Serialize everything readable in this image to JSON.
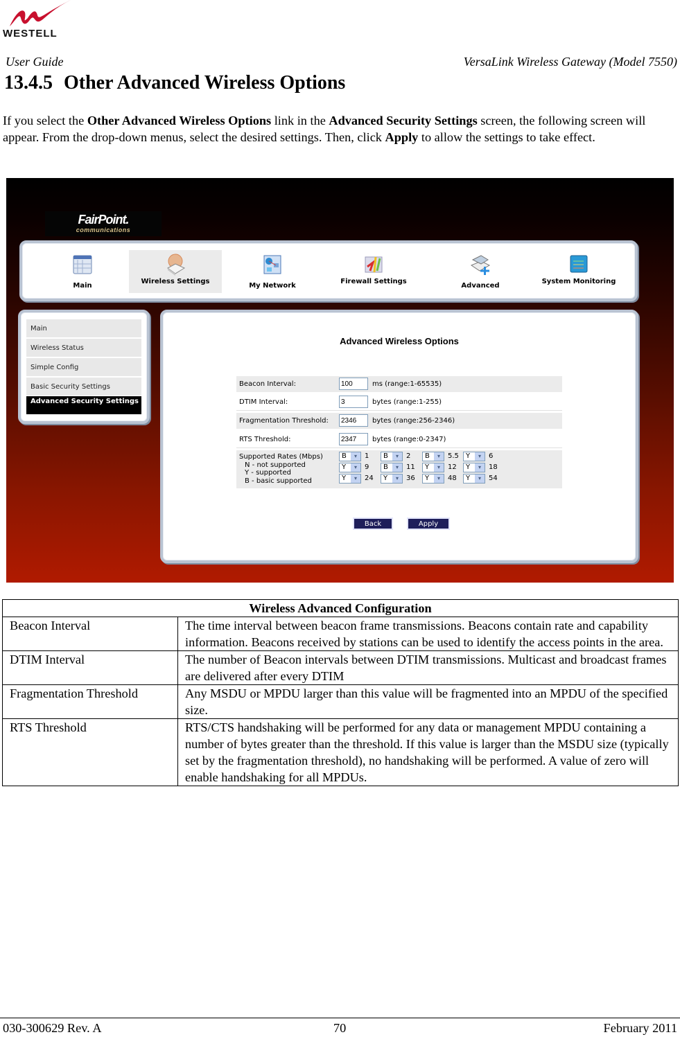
{
  "header": {
    "brand": "WESTELL",
    "left": "User Guide",
    "right": "VersaLink Wireless Gateway (Model 7550)"
  },
  "section": {
    "number": "13.4.5",
    "title": "Other Advanced Wireless Options"
  },
  "intro": {
    "p1": "If you select the ",
    "b1": "Other Advanced Wireless Options",
    "p2": " link in the ",
    "b2": "Advanced Security Settings",
    "p3": " screen, the following screen will appear. From the drop-down menus, select the desired settings. Then, click ",
    "b3": "Apply",
    "p4": " to allow the settings to take effect."
  },
  "screenshot": {
    "brand_main": "FairPoint.",
    "brand_sub": "communications",
    "nav": [
      {
        "label": "Main",
        "icon": "main-icon"
      },
      {
        "label": "Wireless Settings",
        "icon": "wireless-settings-icon",
        "active": true
      },
      {
        "label": "My Network",
        "icon": "my-network-icon"
      },
      {
        "label": "Firewall Settings",
        "icon": "firewall-icon"
      },
      {
        "label": "Advanced",
        "icon": "advanced-icon"
      },
      {
        "label": "System Monitoring",
        "icon": "system-monitoring-icon"
      }
    ],
    "sidebar": [
      {
        "label": "Main"
      },
      {
        "label": "Wireless Status"
      },
      {
        "label": "Simple Config"
      },
      {
        "label": "Basic Security Settings"
      },
      {
        "label": "Advanced Security Settings",
        "active": true
      }
    ],
    "content_title": "Advanced Wireless Options",
    "fields": [
      {
        "label": "Beacon Interval:",
        "value": "100",
        "range": "ms (range:1-65535)"
      },
      {
        "label": "DTIM Interval:",
        "value": "3",
        "range": "bytes (range:1-255)"
      },
      {
        "label": "Fragmentation Threshold:",
        "value": "2346",
        "range": "bytes (range:256-2346)"
      },
      {
        "label": "RTS Threshold:",
        "value": "2347",
        "range": "bytes (range:0-2347)"
      }
    ],
    "rates_legend": [
      "Supported Rates (Mbps)",
      "  N - not supported",
      "  Y - supported",
      "  B - basic supported"
    ],
    "rates": [
      {
        "sel": "B",
        "rate": "1"
      },
      {
        "sel": "B",
        "rate": "2"
      },
      {
        "sel": "B",
        "rate": "5.5"
      },
      {
        "sel": "Y",
        "rate": "6"
      },
      {
        "sel": "Y",
        "rate": "9"
      },
      {
        "sel": "B",
        "rate": "11"
      },
      {
        "sel": "Y",
        "rate": "12"
      },
      {
        "sel": "Y",
        "rate": "18"
      },
      {
        "sel": "Y",
        "rate": "24"
      },
      {
        "sel": "Y",
        "rate": "36"
      },
      {
        "sel": "Y",
        "rate": "48"
      },
      {
        "sel": "Y",
        "rate": "54"
      }
    ],
    "buttons": {
      "back": "Back",
      "apply": "Apply"
    },
    "dropdown_arrow": "▾"
  },
  "table": {
    "title": "Wireless Advanced Configuration",
    "rows": [
      {
        "key": "Beacon Interval",
        "desc": "The time interval between beacon frame transmissions. Beacons contain rate and capability information. Beacons received by stations can be used to identify the access points in the area."
      },
      {
        "key": "DTIM Interval",
        "desc": "The number of Beacon intervals between DTIM transmissions. Multicast and broadcast frames are delivered after every DTIM"
      },
      {
        "key": "Fragmentation Threshold",
        "desc": "Any MSDU or MPDU larger than this value will be fragmented into an MPDU of the specified size."
      },
      {
        "key": "RTS Threshold",
        "desc": "RTS/CTS handshaking will be performed for any data or management MPDU containing a number of bytes greater than the threshold. If this value is larger than the MSDU size (typically set by the fragmentation threshold), no handshaking will be performed. A value of zero will enable handshaking for all MPDUs."
      }
    ]
  },
  "footer": {
    "left": "030-300629 Rev. A",
    "center": "70",
    "right": "February 2011"
  },
  "colors": {
    "logo_red": "#c8102e",
    "button_navy": "#1e1e5a",
    "sidebar_active": "#000000",
    "gradient_bottom": "#b01a00"
  }
}
